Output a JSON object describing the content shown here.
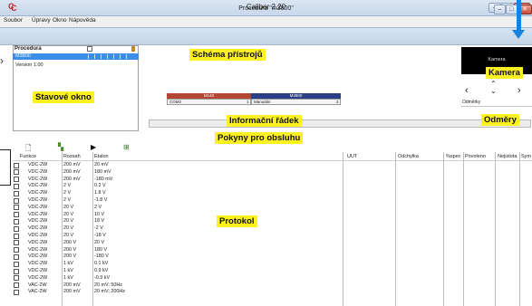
{
  "app": {
    "logo": "C",
    "title": "Caliber 2.20",
    "minimize": "–",
    "maximize": "□",
    "close": "✕"
  },
  "menu": [
    "Soubor",
    "Úpravy",
    "Okno",
    "Nápověda"
  ],
  "inner_window": {
    "logo": "C",
    "title": "Procedura \"m3800\"",
    "minimize": "–",
    "maximize": "□",
    "close": "✕"
  },
  "state_panel": {
    "header": "Procedura",
    "procedure_name": "M3800",
    "version": "Version 1.00"
  },
  "diagram": {
    "device1": {
      "name": "M140",
      "port_left": "COM2",
      "port_right": "1",
      "color": "#b34733"
    },
    "device2": {
      "name": "M3800",
      "port_left": "Manuální",
      "port_right": "2",
      "color": "#2a3f86"
    }
  },
  "camera": {
    "view_label": "Kamera",
    "odmerky": "Odměrky"
  },
  "toolbar": {
    "new": "new-document-icon",
    "tree": "tree-icon",
    "play": "play-icon",
    "export": "export-icon"
  },
  "table": {
    "columns": [
      "Funkce",
      "Rozsah",
      "Etalon",
      "UUT",
      "Odchylka",
      "%spec",
      "Povoleno",
      "Nejistota",
      "Sym"
    ],
    "rows": [
      [
        "VDC-2W",
        "200 mV",
        "20 mV"
      ],
      [
        "VDC-2W",
        "200 mV",
        "180 mV"
      ],
      [
        "VDC-2W",
        "200 mV",
        "-180 mV"
      ],
      [
        "VDC-2W",
        "2 V",
        "0.2 V"
      ],
      [
        "VDC-2W",
        "2 V",
        "1.8 V"
      ],
      [
        "VDC-2W",
        "2 V",
        "-1.8 V"
      ],
      [
        "VDC-2W",
        "20 V",
        "2 V"
      ],
      [
        "VDC-2W",
        "20 V",
        "10 V"
      ],
      [
        "VDC-2W",
        "20 V",
        "18 V"
      ],
      [
        "VDC-2W",
        "20 V",
        "-2 V"
      ],
      [
        "VDC-2W",
        "20 V",
        "-18 V"
      ],
      [
        "VDC-2W",
        "200 V",
        "20 V"
      ],
      [
        "VDC-2W",
        "200 V",
        "180 V"
      ],
      [
        "VDC-2W",
        "200 V",
        "-180 V"
      ],
      [
        "VDC-2W",
        "1 kV",
        "0.1 kV"
      ],
      [
        "VDC-2W",
        "1 kV",
        "0.9 kV"
      ],
      [
        "VDC-2W",
        "1 kV",
        "-0.9 kV"
      ],
      [
        "VAC-2W",
        "200 mV",
        "20 mV; 50Hz"
      ],
      [
        "VAC-2W",
        "200 mV",
        "20 mV; 200Hz"
      ]
    ]
  },
  "callouts": {
    "schema": "Schéma přístrojů",
    "stav": "Stavové okno",
    "info": "Informační řádek",
    "pokyny": "Pokyny pro obsluhu",
    "protokol": "Protokol",
    "kamera": "Kamera",
    "odmery": "Odměry"
  },
  "colors": {
    "accent_blue": "#1583e0",
    "highlight_yellow": "#fdf21f",
    "selection_blue": "#3a8ee6"
  }
}
